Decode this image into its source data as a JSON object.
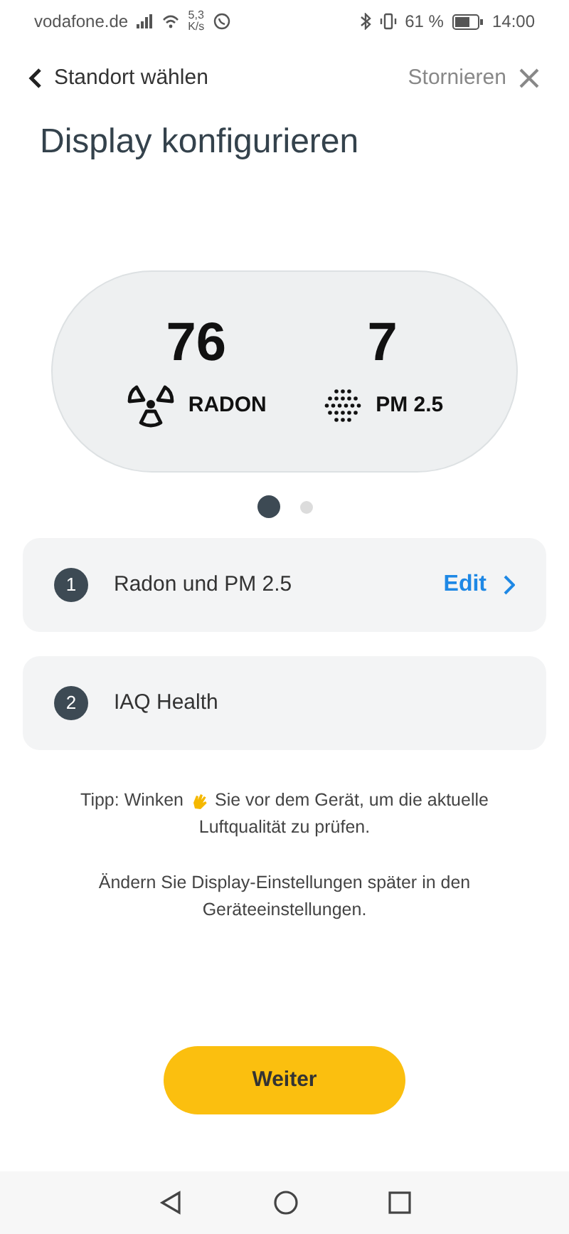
{
  "status_bar": {
    "carrier": "vodafone.de",
    "speed_value": "5,3",
    "speed_unit": "K/s",
    "battery_percent": "61 %",
    "time": "14:00"
  },
  "nav": {
    "back_label": "Standort wählen",
    "cancel_label": "Stornieren"
  },
  "title": "Display konfigurieren",
  "preview": {
    "readings": [
      {
        "kind": "radon",
        "value": "76",
        "label": "RADON"
      },
      {
        "kind": "particles",
        "value": "7",
        "label": "PM 2.5"
      }
    ]
  },
  "pager": [
    {
      "selected": true
    },
    {
      "selected": false
    }
  ],
  "options": [
    {
      "number": "1",
      "label": "Radon und PM 2.5",
      "action": "Edit"
    },
    {
      "number": "2",
      "label": "IAQ Health"
    }
  ],
  "tip": {
    "before": "Tipp: Winken",
    "after": "Sie vor dem Gerät, um die aktuelle",
    "continuation": "Luftqualität zu prüfen."
  },
  "note": "Ändern Sie Display-Einstellungen später in den Geräteeinstellungen.",
  "primary_button": "Weiter"
}
